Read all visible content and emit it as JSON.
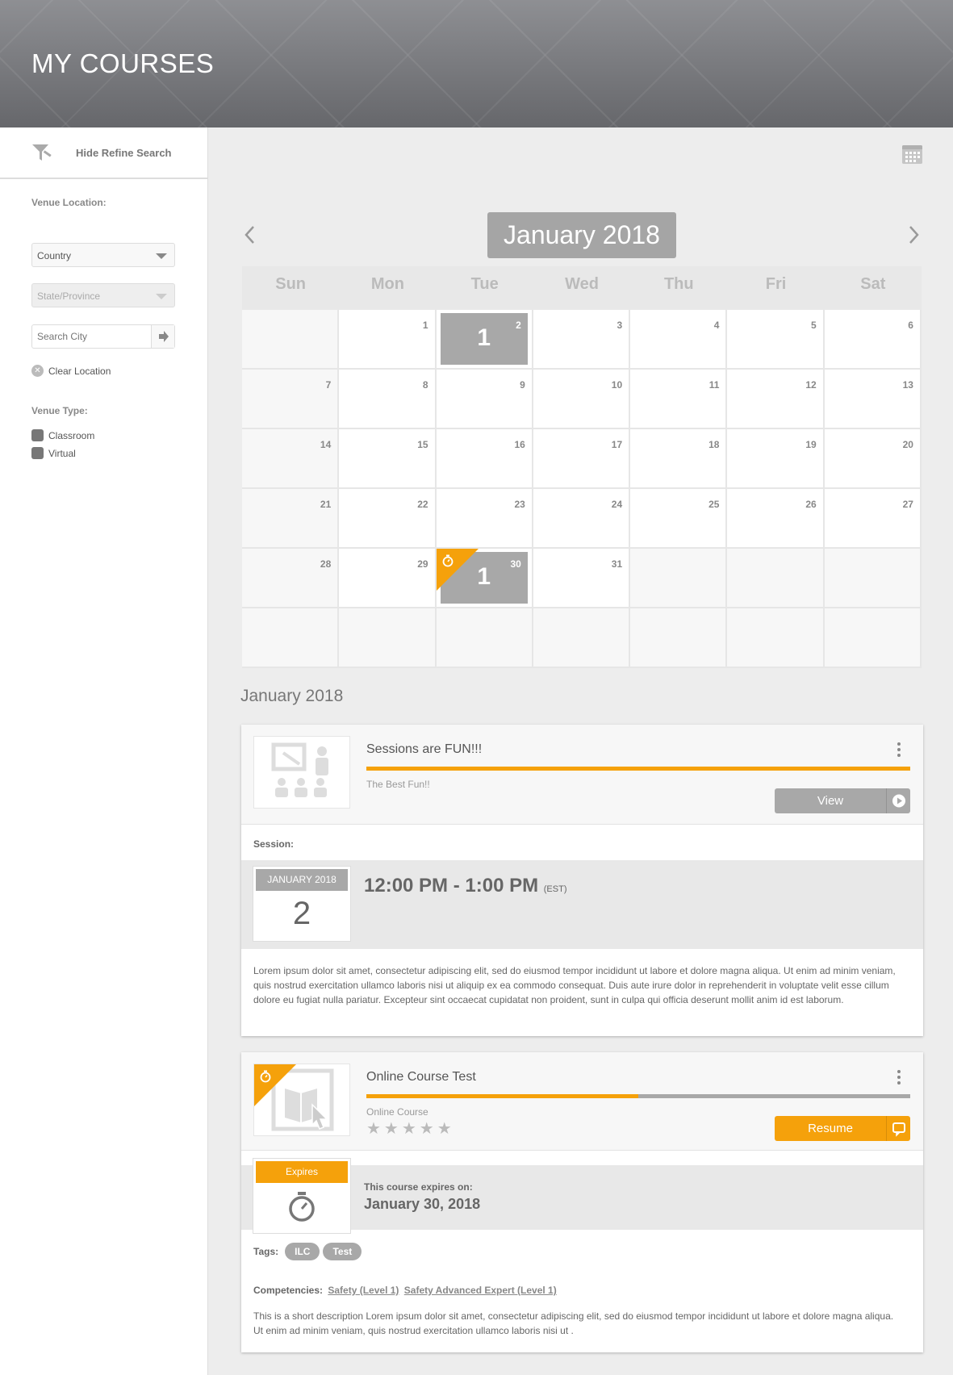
{
  "header": {
    "title": "MY COURSES"
  },
  "sidebar": {
    "refine_label": "Hide Refine Search",
    "venue_location_label": "Venue Location:",
    "country_select": "Country",
    "state_select": "State/Province",
    "city_placeholder": "Search City",
    "clear_location": "Clear Location",
    "venue_type_label": "Venue Type:",
    "venue_types": [
      "Classroom",
      "Virtual"
    ]
  },
  "calendar": {
    "month_title": "January 2018",
    "weekdays": [
      "Sun",
      "Mon",
      "Tue",
      "Wed",
      "Thu",
      "Fri",
      "Sat"
    ],
    "days": [
      "",
      "1",
      "2",
      "3",
      "4",
      "5",
      "6",
      "7",
      "8",
      "9",
      "10",
      "11",
      "12",
      "13",
      "14",
      "15",
      "16",
      "17",
      "18",
      "19",
      "20",
      "21",
      "22",
      "23",
      "24",
      "25",
      "26",
      "27",
      "28",
      "29",
      "30",
      "31",
      "",
      "",
      "",
      "",
      "",
      "",
      "",
      "",
      "",
      ""
    ],
    "events": {
      "2": "1",
      "30": "1"
    },
    "expiring_day": "30"
  },
  "list": {
    "month_heading": "January 2018",
    "session_card": {
      "title": "Sessions are FUN!!!",
      "subtitle": "The Best Fun!!",
      "progress": 1.0,
      "button": "View",
      "session_label": "Session:",
      "date_month": "JANUARY 2018",
      "date_day": "2",
      "time": "12:00 PM - 1:00 PM",
      "timezone": "(EST)",
      "description": "Lorem ipsum dolor sit amet, consectetur adipiscing elit, sed do eiusmod tempor incididunt ut labore et dolore magna aliqua. Ut enim ad minim veniam, quis nostrud exercitation ullamco laboris nisi ut aliquip ex ea commodo consequat. Duis aute irure dolor in reprehenderit in voluptate velit esse cillum dolore eu fugiat nulla pariatur. Excepteur sint occaecat cupidatat non proident, sunt in culpa qui officia deserunt mollit anim id est laborum."
    },
    "online_card": {
      "title": "Online Course Test",
      "subtitle": "Online Course",
      "progress": 0.5,
      "rating_stars": "★★★★★",
      "button": "Resume",
      "expires_badge": "Expires",
      "expires_label": "This course expires on:",
      "expires_date": "January 30, 2018",
      "tags_label": "Tags:",
      "tags": [
        "ILC",
        "Test"
      ],
      "competencies_label": "Competencies:",
      "competencies": [
        "Safety (Level 1)",
        "Safety Advanced Expert (Level 1)"
      ],
      "description": "This is a short description Lorem ipsum dolor sit amet, consectetur adipiscing elit, sed do eiusmod tempor incididunt ut labore et dolore magna aliqua. Ut enim ad minim veniam, quis nostrud exercitation ullamco laboris nisi ut ."
    }
  },
  "colors": {
    "accent": "#f5a10b",
    "event": "#a8a8a8",
    "header": "#6e6f73"
  }
}
